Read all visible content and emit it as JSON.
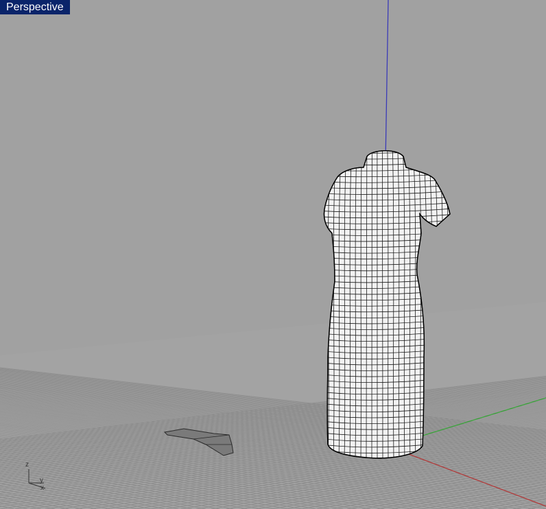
{
  "viewport": {
    "title": "Perspective",
    "title_bg": "#0a246a",
    "title_fg": "#ffffff",
    "background": "#a1a1a1",
    "grid_color": "#8c8c8c",
    "axis_colors": {
      "x": "#b03a3a",
      "y": "#3aa33a",
      "z": "#3a3ab8"
    }
  },
  "axis_widget": {
    "labels": [
      "z",
      "y",
      "x"
    ],
    "icon": "world-axes-icon"
  },
  "objects": [
    {
      "name": "dress-form-mesh",
      "icon": "mesh-object-icon"
    },
    {
      "name": "flat-pattern-piece",
      "icon": "surface-object-icon"
    }
  ]
}
